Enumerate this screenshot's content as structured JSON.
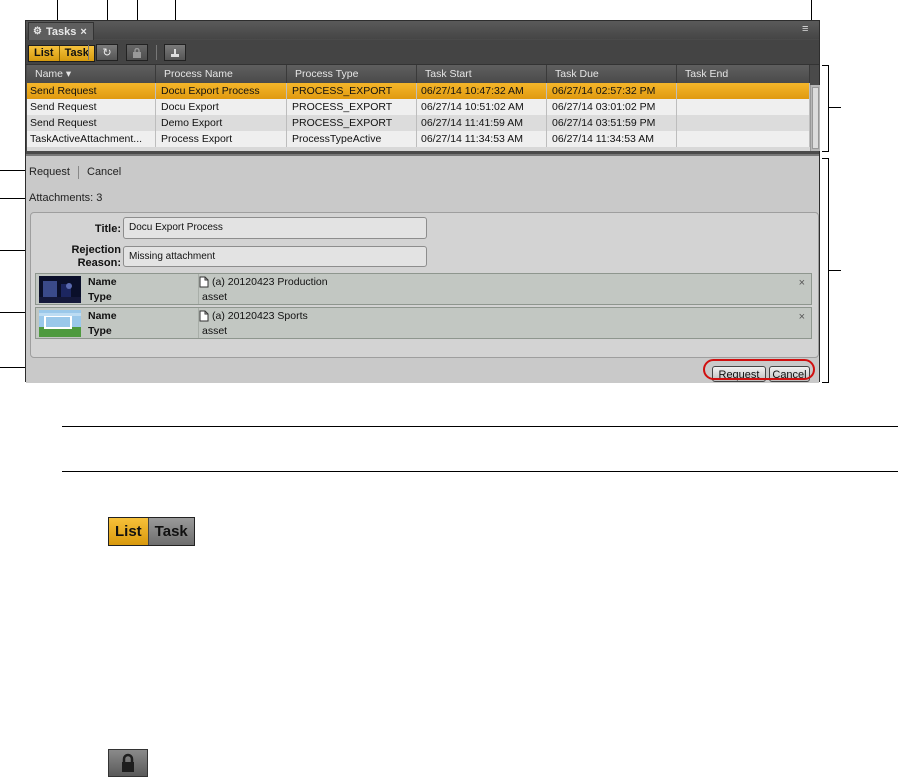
{
  "panel": {
    "tab_label": "Tasks",
    "tab_close": "×",
    "menu_glyph": "≡"
  },
  "toolbar": {
    "list_label": "List",
    "task_label": "Task",
    "refresh_glyph": "↻",
    "lock_glyph": "🔒",
    "export_glyph": "⏏"
  },
  "grid": {
    "columns": [
      "Name ▾",
      "Process Name",
      "Process Type",
      "Task Start",
      "Task Due",
      "Task End"
    ],
    "rows": [
      [
        "Send Request",
        "Docu Export Process",
        "PROCESS_EXPORT",
        "06/27/14 10:47:32 AM",
        "06/27/14 02:57:32 PM",
        ""
      ],
      [
        "Send Request",
        "Docu Export",
        "PROCESS_EXPORT",
        "06/27/14 10:51:02 AM",
        "06/27/14 03:01:02 PM",
        ""
      ],
      [
        "Send Request",
        "Demo Export",
        "PROCESS_EXPORT",
        "06/27/14 11:41:59 AM",
        "06/27/14 03:51:59 PM",
        ""
      ],
      [
        "TaskActiveAttachment...",
        "Process Export",
        "ProcessTypeActive",
        "06/27/14 11:34:53 AM",
        "06/27/14 11:34:53 AM",
        ""
      ]
    ]
  },
  "details": {
    "request_link": "Request",
    "cancel_link": "Cancel",
    "attachments_text": "Attachments: 3",
    "title_label": "Title:",
    "title_value": "Docu Export Process",
    "rejection_label_1": "Rejection",
    "rejection_label_2": "Reason:",
    "rejection_value": "Missing attachment",
    "assets": [
      {
        "name_key": "Name",
        "type_key": "Type",
        "name": "(a) 20120423 Production",
        "type": "asset",
        "remove": "×"
      },
      {
        "name_key": "Name",
        "type_key": "Type",
        "name": "(a) 20120423 Sports",
        "type": "asset",
        "remove": "×"
      }
    ],
    "request_button": "Request",
    "cancel_button": "Cancel"
  },
  "doc": {
    "list_label": "List",
    "task_label": "Task"
  },
  "colors": {
    "accent": "#e8a516",
    "panel_bg": "#4a4a4a",
    "highlight_ring": "#d01010"
  }
}
